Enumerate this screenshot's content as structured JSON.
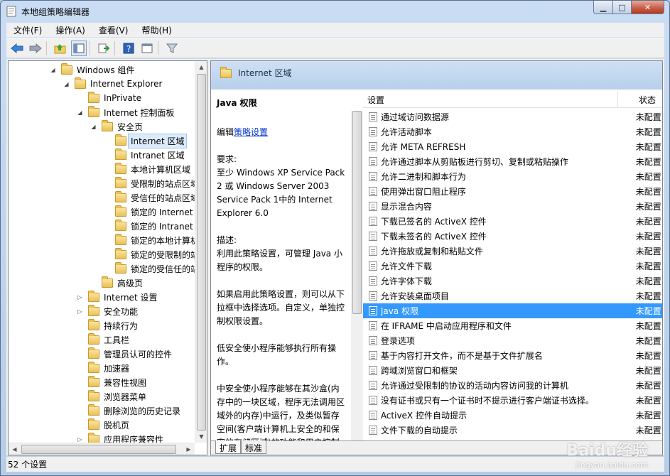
{
  "window": {
    "title": "本地组策略编辑器"
  },
  "menu": [
    "文件(F)",
    "操作(A)",
    "查看(V)",
    "帮助(H)"
  ],
  "toolbar": [
    "back-icon",
    "forward-icon",
    "up-folder-icon",
    "show-hide-tree-icon",
    "export-icon",
    "help-icon",
    "properties-icon",
    "filter-icon"
  ],
  "tree": [
    {
      "label": "Windows 组件",
      "exp": "collapse"
    },
    {
      "label": "Internet Explorer",
      "exp": "collapse"
    },
    {
      "label": "InPrivate",
      "exp": ""
    },
    {
      "label": "Internet 控制面板",
      "exp": "collapse"
    },
    {
      "label": "安全页",
      "exp": "collapse"
    },
    {
      "label": "Internet 区域",
      "exp": ""
    },
    {
      "label": "Intranet 区域",
      "exp": ""
    },
    {
      "label": "本地计算机区域",
      "exp": ""
    },
    {
      "label": "受限制的站点区域",
      "exp": ""
    },
    {
      "label": "受信任的站点区域",
      "exp": ""
    },
    {
      "label": "锁定的 Internet 区",
      "exp": ""
    },
    {
      "label": "锁定的 Intranet 区",
      "exp": ""
    },
    {
      "label": "锁定的本地计算机",
      "exp": ""
    },
    {
      "label": "锁定的受限制的站",
      "exp": ""
    },
    {
      "label": "锁定的受信任的站",
      "exp": ""
    },
    {
      "label": "高级页",
      "exp": ""
    },
    {
      "label": "Internet 设置",
      "exp": "expand"
    },
    {
      "label": "安全功能",
      "exp": "expand"
    },
    {
      "label": "持续行为",
      "exp": ""
    },
    {
      "label": "工具栏",
      "exp": ""
    },
    {
      "label": "管理员认可的控件",
      "exp": ""
    },
    {
      "label": "加速器",
      "exp": ""
    },
    {
      "label": "兼容性视图",
      "exp": ""
    },
    {
      "label": "浏览器菜单",
      "exp": ""
    },
    {
      "label": "删除浏览的历史记录",
      "exp": ""
    },
    {
      "label": "脱机页",
      "exp": ""
    },
    {
      "label": "应用程序兼容性",
      "exp": "expand"
    }
  ],
  "pane": {
    "header": "Internet 区域",
    "desc_title": "Java 权限",
    "edit_prefix": "编辑",
    "edit_link": "策略设置",
    "req_label": "要求:",
    "req_text": "至少 Windows XP Service Pack 2 或 Windows Server 2003 Service Pack 1中的 Internet Explorer 6.0",
    "desc_label": "描述:",
    "desc_p1": "利用此策略设置，可管理 Java 小程序的权限。",
    "desc_p2": "如果启用此策略设置，则可以从下拉框中选择选项。自定义，单独控制权限设置。",
    "desc_p3": "低安全使小程序能够执行所有操作。",
    "desc_p4": "中安全使小程序能够在其沙盒(内存中的一块区域，程序无法调用区域外的内存)中运行，及类似暂存空间(客户端计算机上安全的和保密的存储区域)的功能和用户控制的文件"
  },
  "columns": {
    "setting": "设置",
    "state": "状态"
  },
  "settings": [
    {
      "name": "通过域访问数据源",
      "state": "未配置"
    },
    {
      "name": "允许活动脚本",
      "state": "未配置"
    },
    {
      "name": "允许 META REFRESH",
      "state": "未配置"
    },
    {
      "name": "允许通过脚本从剪贴板进行剪切、复制或粘贴操作",
      "state": "未配置"
    },
    {
      "name": "允许二进制和脚本行为",
      "state": "未配置"
    },
    {
      "name": "使用弹出窗口阻止程序",
      "state": "未配置"
    },
    {
      "name": "显示混合内容",
      "state": "未配置"
    },
    {
      "name": "下载已签名的 ActiveX 控件",
      "state": "未配置"
    },
    {
      "name": "下载未签名的 ActiveX 控件",
      "state": "未配置"
    },
    {
      "name": "允许拖放或复制和粘贴文件",
      "state": "未配置"
    },
    {
      "name": "允许文件下载",
      "state": "未配置"
    },
    {
      "name": "允许字体下载",
      "state": "未配置"
    },
    {
      "name": "允许安装桌面项目",
      "state": "未配置"
    },
    {
      "name": "Java 权限",
      "state": "未配置"
    },
    {
      "name": "在 IFRAME 中启动应用程序和文件",
      "state": "未配置"
    },
    {
      "name": "登录选项",
      "state": "未配置"
    },
    {
      "name": "基于内容打开文件，而不是基于文件扩展名",
      "state": "未配置"
    },
    {
      "name": "跨域浏览窗口和框架",
      "state": "未配置"
    },
    {
      "name": "允许通过受限制的协议的活动内容访问我的计算机",
      "state": "未配置"
    },
    {
      "name": "没有证书或只有一个证书时不提示进行客户端证书选择。",
      "state": "未配置"
    },
    {
      "name": "ActiveX 控件自动提示",
      "state": "未配置"
    },
    {
      "name": "文件下载的自动提示",
      "state": "未配置"
    }
  ],
  "tabs": [
    "扩展",
    "标准"
  ],
  "status": "52 个设置",
  "watermark": {
    "brand": "Baidu经验",
    "url": "jingyan.baidu.com"
  }
}
